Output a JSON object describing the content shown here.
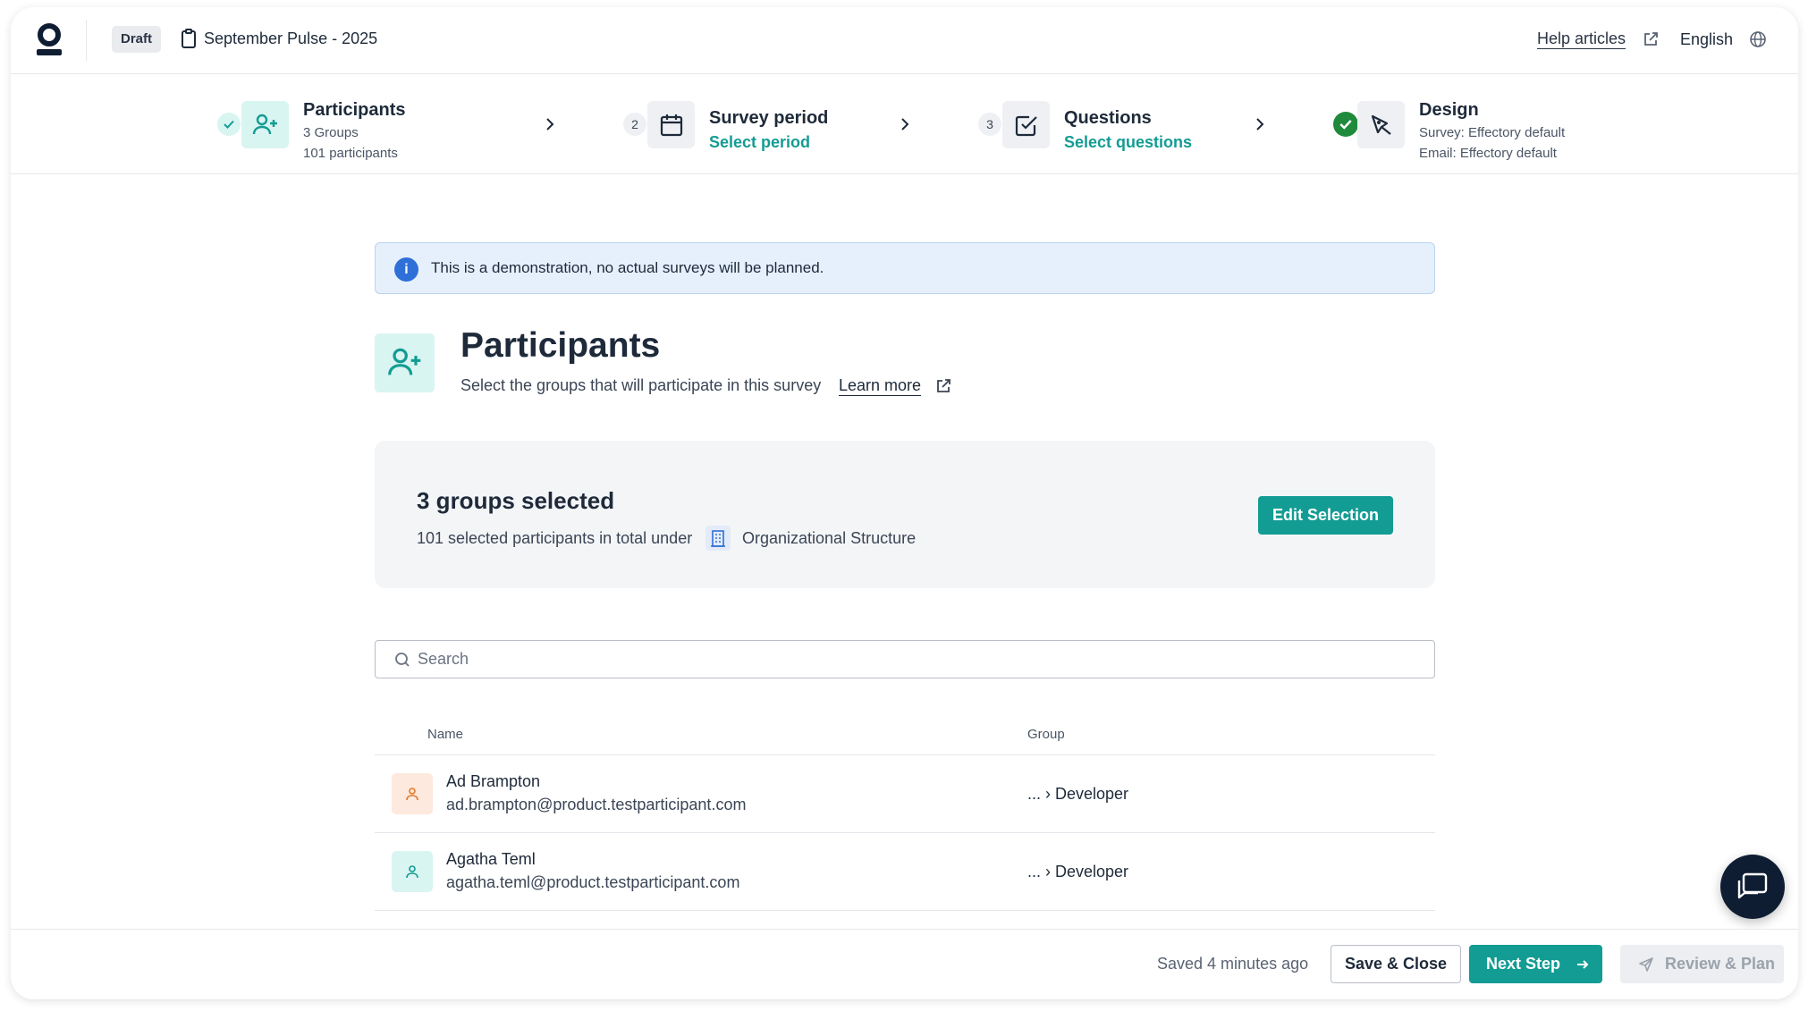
{
  "header": {
    "status_badge": "Draft",
    "survey_title": "September Pulse - 2025",
    "help_label": "Help articles",
    "language": "English"
  },
  "stepper": {
    "steps": [
      {
        "number": "",
        "title": "Participants",
        "line1": "3 Groups",
        "line2": "101 participants"
      },
      {
        "number": "2",
        "title": "Survey period",
        "link": "Select period"
      },
      {
        "number": "3",
        "title": "Questions",
        "link": "Select questions"
      },
      {
        "number": "",
        "title": "Design",
        "line1": "Survey: Effectory default",
        "line2": "Email: Effectory default"
      }
    ]
  },
  "banner": {
    "text": "This is a demonstration, no actual surveys will be planned."
  },
  "participants": {
    "title": "Participants",
    "subtitle": "Select the groups that will participate in this survey",
    "learn_more": "Learn more"
  },
  "selection": {
    "title": "3 groups selected",
    "summary": "101 selected participants in total under",
    "structure": "Organizational Structure",
    "edit_label": "Edit Selection"
  },
  "search": {
    "placeholder": "Search"
  },
  "table": {
    "columns": {
      "name": "Name",
      "group": "Group"
    },
    "rows": [
      {
        "name": "Ad Brampton",
        "email": "ad.brampton@product.testparticipant.com",
        "group": "... › Developer",
        "avatar_color": "#fde9dd"
      },
      {
        "name": "Agatha Teml",
        "email": "agatha.teml@product.testparticipant.com",
        "group": "... › Developer",
        "avatar_color": "#d9f5f1"
      }
    ]
  },
  "footer": {
    "saved_text": "Saved 4 minutes ago",
    "save_close": "Save & Close",
    "next_step": "Next Step",
    "review_plan": "Review & Plan"
  },
  "colors": {
    "accent": "#139c93",
    "info": "#2f6fd8",
    "success": "#1f8a3c",
    "dark": "#0f1d33"
  }
}
